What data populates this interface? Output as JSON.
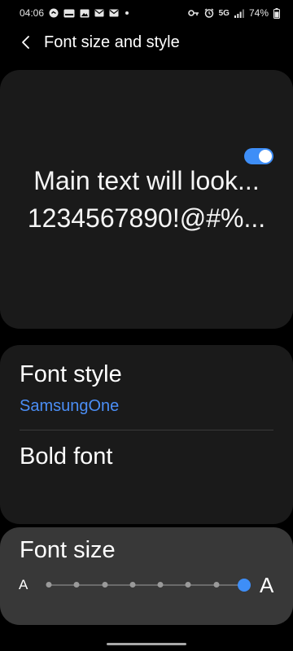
{
  "status_bar": {
    "time": "04:06",
    "network": "5G",
    "battery": "74%",
    "left_icons": [
      "samsung-wallet-icon",
      "pay-icon",
      "gallery-icon",
      "mail-icon",
      "mail-icon",
      "notification-dot"
    ],
    "right_icons": [
      "key-icon",
      "alarm-icon",
      "signal-icon",
      "battery-icon"
    ]
  },
  "header": {
    "title": "Font size and style"
  },
  "preview": {
    "line1": "Main text will look...",
    "line2": "1234567890!@#%..."
  },
  "settings": {
    "font_style_label": "Font style",
    "font_style_value": "SamsungOne",
    "bold_font_label": "Bold font",
    "bold_font_enabled": true
  },
  "font_size": {
    "label": "Font size",
    "small_label": "A",
    "large_label": "A",
    "steps": 8,
    "value_index": 7
  },
  "colors": {
    "accent": "#3e8ef7",
    "link": "#4b8ef5",
    "card_bg": "#1a1a1a",
    "active_card_bg": "#383838"
  }
}
